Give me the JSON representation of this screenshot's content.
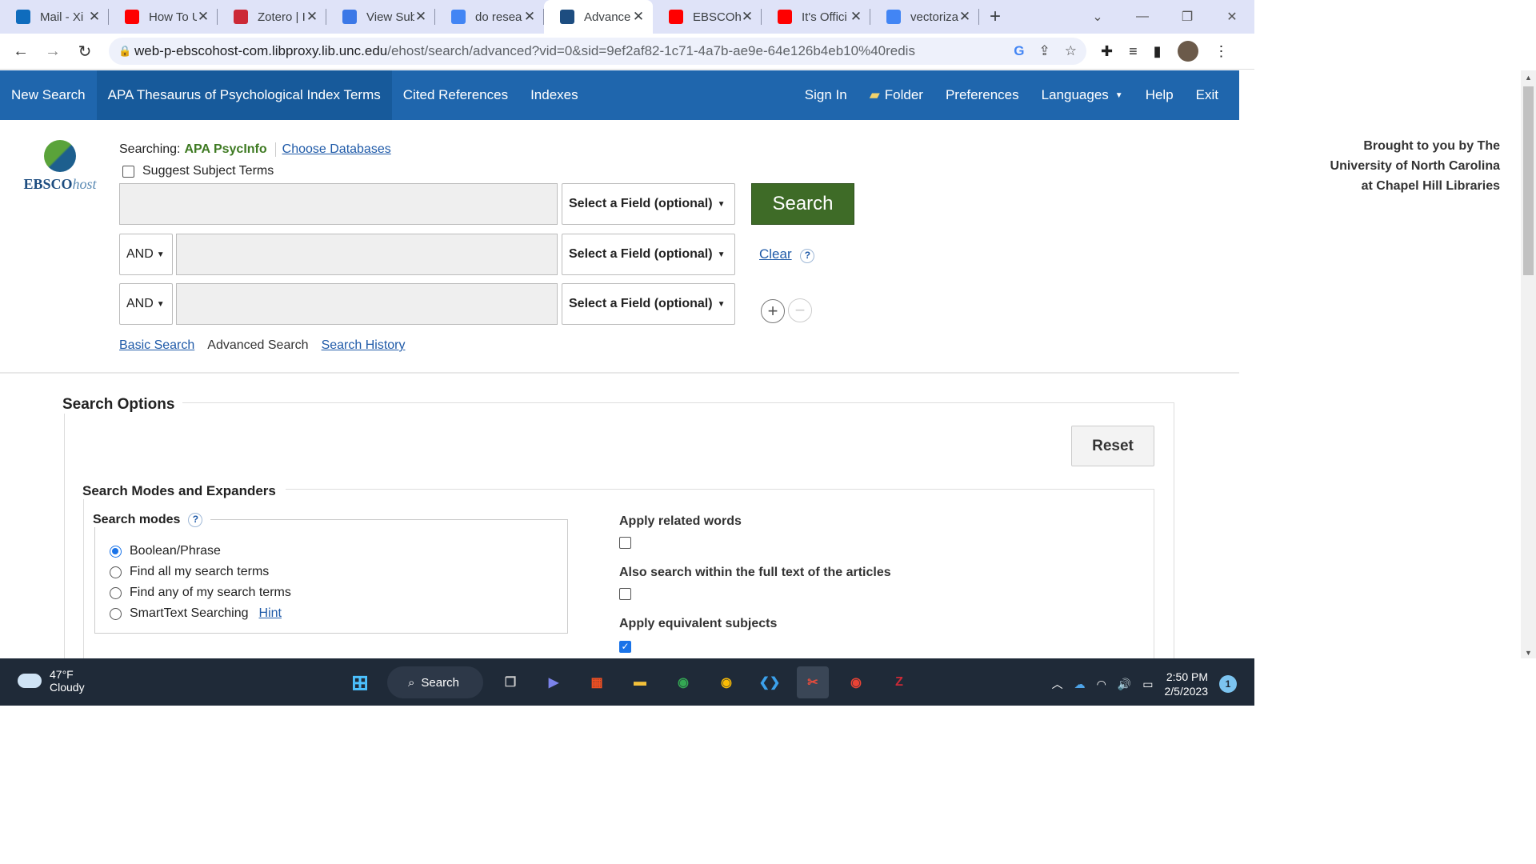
{
  "browser": {
    "tabs": [
      {
        "title": "Mail - Xi",
        "icon": "outlook-icon",
        "color": "#0f6cbd"
      },
      {
        "title": "How To U",
        "icon": "youtube-icon",
        "color": "#ff0000"
      },
      {
        "title": "Zotero | I",
        "icon": "zotero-icon",
        "color": "#cc2936"
      },
      {
        "title": "View Sub",
        "icon": "chart-icon",
        "color": "#3b78e7"
      },
      {
        "title": "do resea",
        "icon": "google-icon",
        "color": "#4285f4"
      },
      {
        "title": "Advance",
        "icon": "ebsco-icon",
        "color": "#1d4d80",
        "active": true
      },
      {
        "title": "EBSCOho",
        "icon": "youtube-icon",
        "color": "#ff0000"
      },
      {
        "title": "It's Offici",
        "icon": "youtube-icon",
        "color": "#ff0000"
      },
      {
        "title": "vectoriza",
        "icon": "google-icon",
        "color": "#4285f4"
      }
    ],
    "url_host": "web-p-ebscohost-com.libproxy.lib.unc.edu",
    "url_path": "/ehost/search/advanced?vid=0&sid=9ef2af82-1c71-4a7b-ae9e-64e126b4eb10%40redis"
  },
  "topnav": {
    "left": [
      "New Search",
      "APA Thesaurus of Psychological Index Terms",
      "Cited References",
      "Indexes"
    ],
    "right": [
      "Sign In",
      "Folder",
      "Preferences",
      "Languages",
      "Help",
      "Exit"
    ]
  },
  "logo": {
    "brand_bold": "EBSCO",
    "brand_italic": "host"
  },
  "search": {
    "searching_label": "Searching:",
    "database": "APA PsycInfo",
    "choose_databases": "Choose Databases",
    "suggest_label": "Suggest Subject Terms",
    "field_placeholder": "Select a Field (optional)",
    "bool_op": "AND",
    "search_button": "Search",
    "clear": "Clear",
    "help": "?",
    "add": "+",
    "remove": "−"
  },
  "subnav": {
    "basic": "Basic Search",
    "advanced": "Advanced Search",
    "history": "Search History"
  },
  "brought": {
    "line1": "Brought to you by The",
    "line2": "University of North Carolina",
    "line3": "at Chapel Hill Libraries"
  },
  "options": {
    "title": "Search Options",
    "reset": "Reset",
    "modes_title": "Search Modes and Expanders",
    "search_modes": "Search modes",
    "modes": [
      "Boolean/Phrase",
      "Find all my search terms",
      "Find any of my search terms",
      "SmartText Searching"
    ],
    "hint": "Hint",
    "apply_related": "Apply related words",
    "fulltext": "Also search within the full text of the articles",
    "equivalent": "Apply equivalent subjects"
  },
  "taskbar": {
    "temp": "47°F",
    "weather": "Cloudy",
    "search": "Search",
    "time": "2:50 PM",
    "date": "2/5/2023",
    "notifications": "1"
  },
  "colors": {
    "nav_blue": "#1f66ad",
    "search_green": "#3e6b27",
    "db_green": "#3e7a22",
    "link_blue": "#1f5aa8"
  }
}
